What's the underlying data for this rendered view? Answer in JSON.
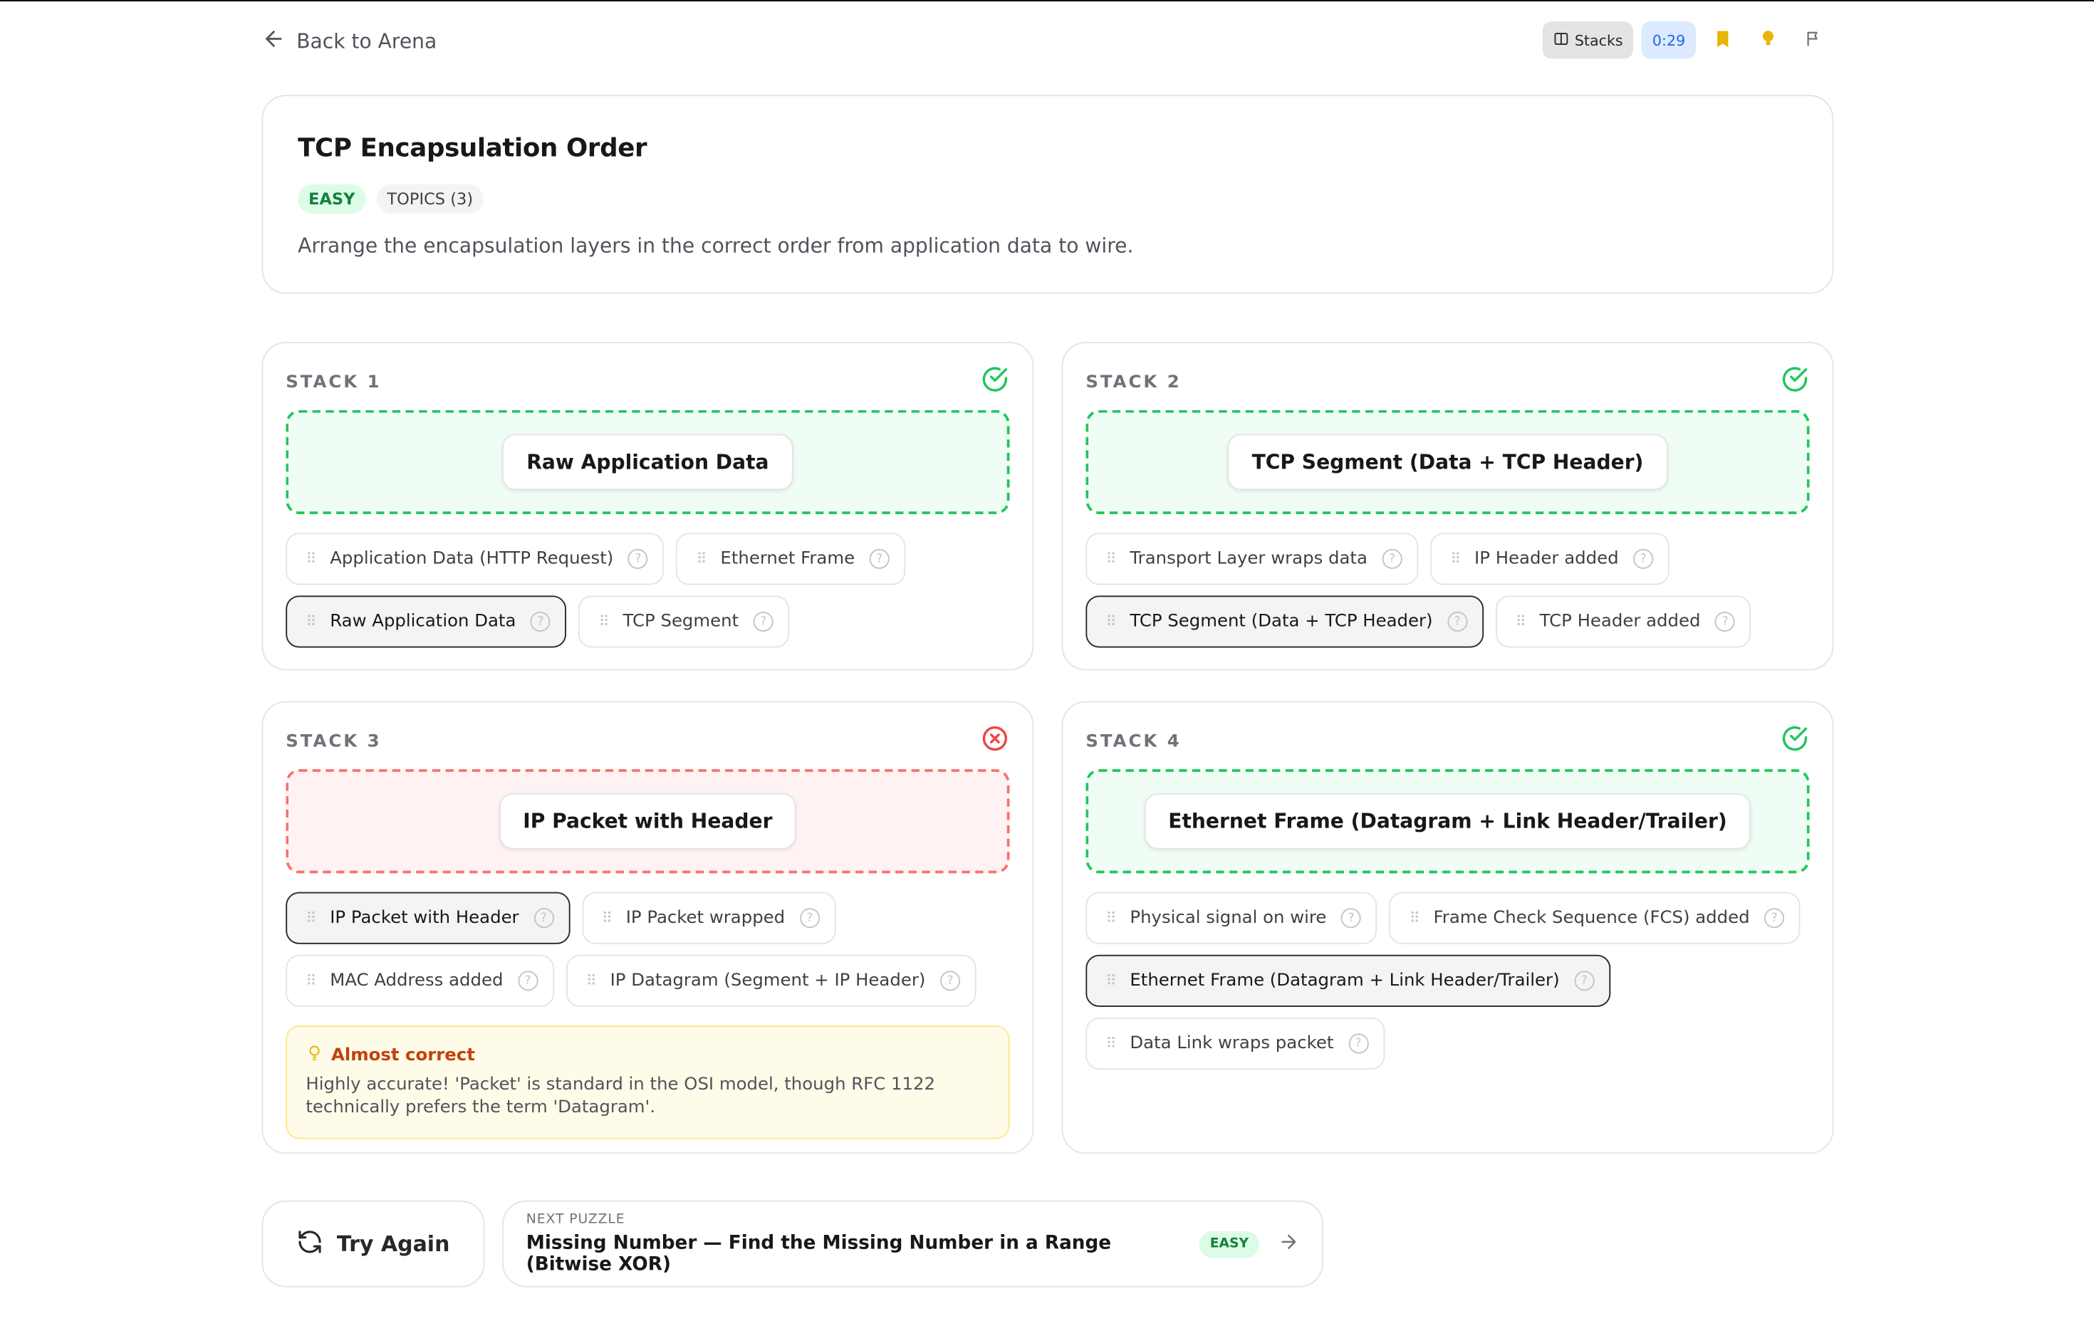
{
  "nav": {
    "back_label": "Back to Arena"
  },
  "toolbar": {
    "stacks_label": "Stacks",
    "timer": "0:29",
    "bookmark_color": "#eab308",
    "hint_color": "#eab308"
  },
  "puzzle": {
    "title": "TCP Encapsulation Order",
    "difficulty": "EASY",
    "topics_label": "TOPICS (3)",
    "description": "Arrange the encapsulation layers in the correct order from application data to wire."
  },
  "stacks": [
    {
      "label": "STACK 1",
      "status": "correct",
      "placed": "Raw Application Data",
      "options": [
        "Application Data (HTTP Request)",
        "Ethernet Frame",
        "Raw Application Data",
        "TCP Segment"
      ]
    },
    {
      "label": "STACK 2",
      "status": "correct",
      "placed": "TCP Segment (Data + TCP Header)",
      "options": [
        "Transport Layer wraps data",
        "IP Header added",
        "TCP Segment (Data + TCP Header)",
        "TCP Header added"
      ]
    },
    {
      "label": "STACK 3",
      "status": "incorrect",
      "placed": "IP Packet with Header",
      "options": [
        "IP Packet with Header",
        "IP Packet wrapped",
        "MAC Address added",
        "IP Datagram (Segment + IP Header)"
      ],
      "feedback": {
        "title": "Almost correct",
        "text": "Highly accurate! 'Packet' is standard in the OSI model, though RFC 1122 technically prefers the term 'Datagram'."
      }
    },
    {
      "label": "STACK 4",
      "status": "correct",
      "placed": "Ethernet Frame (Datagram + Link Header/Trailer)",
      "options": [
        "Physical signal on wire",
        "Frame Check Sequence (FCS) added",
        "Ethernet Frame (Datagram + Link Header/Trailer)",
        "Data Link wraps packet"
      ]
    }
  ],
  "actions": {
    "try_again_label": "Try Again",
    "next_kicker": "NEXT PUZZLE",
    "next_title": "Missing Number — Find the Missing Number in a Range (Bitwise XOR)",
    "next_difficulty": "EASY"
  },
  "colors": {
    "success": "#22c55e",
    "error": "#ef4444",
    "accent_blue": "#2563eb",
    "warning_text": "#c2410c"
  }
}
